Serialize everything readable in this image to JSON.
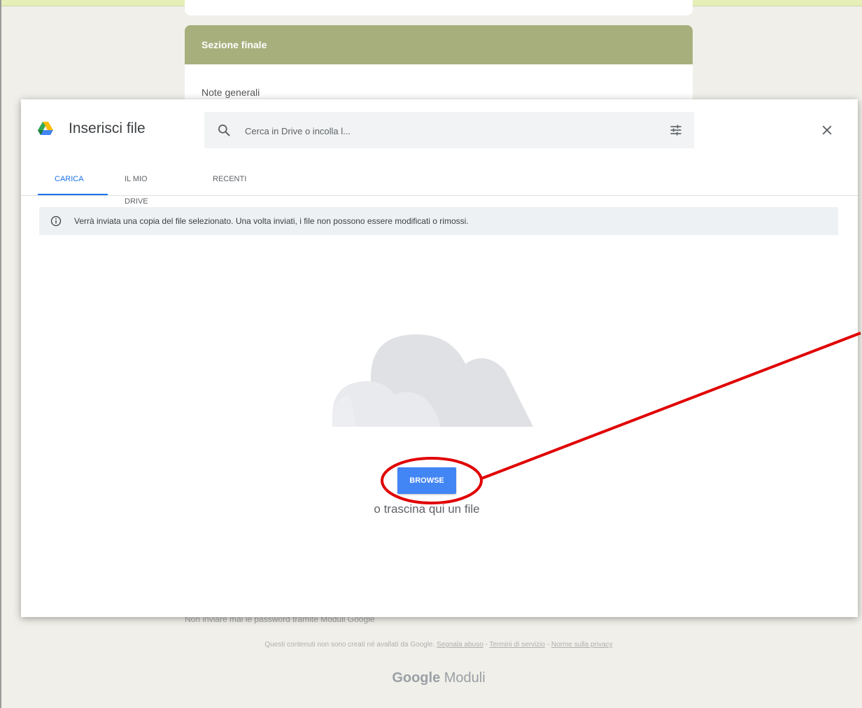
{
  "colors": {
    "page_bg": "#f0efe9",
    "section_header": "#a7b07d",
    "accent": "#1a73e8",
    "browse_button": "#4285f4",
    "annotation": "#e00000"
  },
  "form": {
    "section_title": "Sezione finale",
    "field_label": "Note generali"
  },
  "dialog": {
    "title": "Inserisci file",
    "logo_icon": "google-drive-icon",
    "search": {
      "placeholder": "Cerca in Drive o incolla l...",
      "value": ""
    },
    "tabs": [
      {
        "label": "CARICA",
        "active": true
      },
      {
        "label": "IL MIO DRIVE",
        "active": false
      },
      {
        "label": "RECENTI",
        "active": false
      }
    ],
    "info_message": "Verrà inviata una copia del file selezionato. Una volta inviati, i file non possono essere modificati o rimossi.",
    "browse_label": "BROWSE",
    "drop_hint": "o trascina qui un file"
  },
  "footer": {
    "warning": "Non inviare mai le password tramite Moduli Google",
    "disclaimer": "Questi contenuti non sono creati né avallati da Google.",
    "links": [
      "Segnala abuso",
      "Termini di servizio",
      "Norme sulla privacy"
    ],
    "brand_google": "Google",
    "brand_product": "Moduli"
  }
}
